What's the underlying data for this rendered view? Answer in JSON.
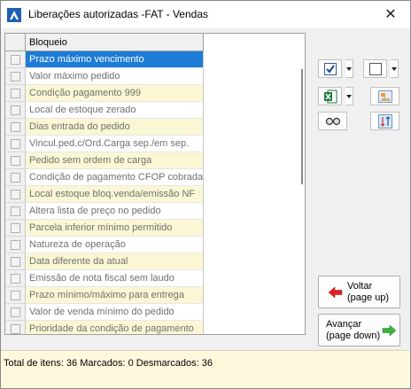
{
  "window": {
    "title": "Liberações autorizadas -FAT - Vendas",
    "close_glyph": "✕"
  },
  "grid": {
    "column_header": "Bloqueio",
    "selected_index": 0,
    "rows": [
      "Prazo máximo vencimento",
      "Valor máximo pedido",
      "Condição pagamento 999",
      "Local de estoque zerado",
      "Dias entrada do pedido",
      "Vincul.ped.c/Ord.Carga sep./em sep.",
      "Pedido sem ordem de carga",
      "Condição de pagamento CFOP cobrada",
      "Local estoque bloq.venda/emissão NF",
      "Altera lista de preço no pedido",
      "Parcela inferior mínimo permitido",
      "Natureza de operação",
      "Data diferente da atual",
      "Emissão de nota fiscal sem laudo",
      "Prazo mínimo/máximo para entrega",
      "Valor de venda mínimo do pedido",
      "Prioridade da condição de pagamento"
    ]
  },
  "toolbar": {
    "mark_all_icon": "checked-checkbox-icon",
    "unmark_all_icon": "empty-checkbox-icon",
    "excel_icon": "excel-export-icon",
    "image_icon": "image-icon",
    "glasses_icon": "glasses-icon",
    "sort_icon": "sort-icon"
  },
  "buttons": {
    "back_line1": "Voltar",
    "back_line2": "(page up)",
    "next_line1": "Avançar",
    "next_line2": "(page down)"
  },
  "status": {
    "text": "Total de itens: 36 Marcados: 0 Desmarcados: 36"
  },
  "colors": {
    "selection": "#1c7cd6",
    "row_alt": "#fbf7d4",
    "status_bg": "#fdf9dd",
    "back_arrow": "#e02020",
    "next_arrow": "#3cb43c"
  }
}
